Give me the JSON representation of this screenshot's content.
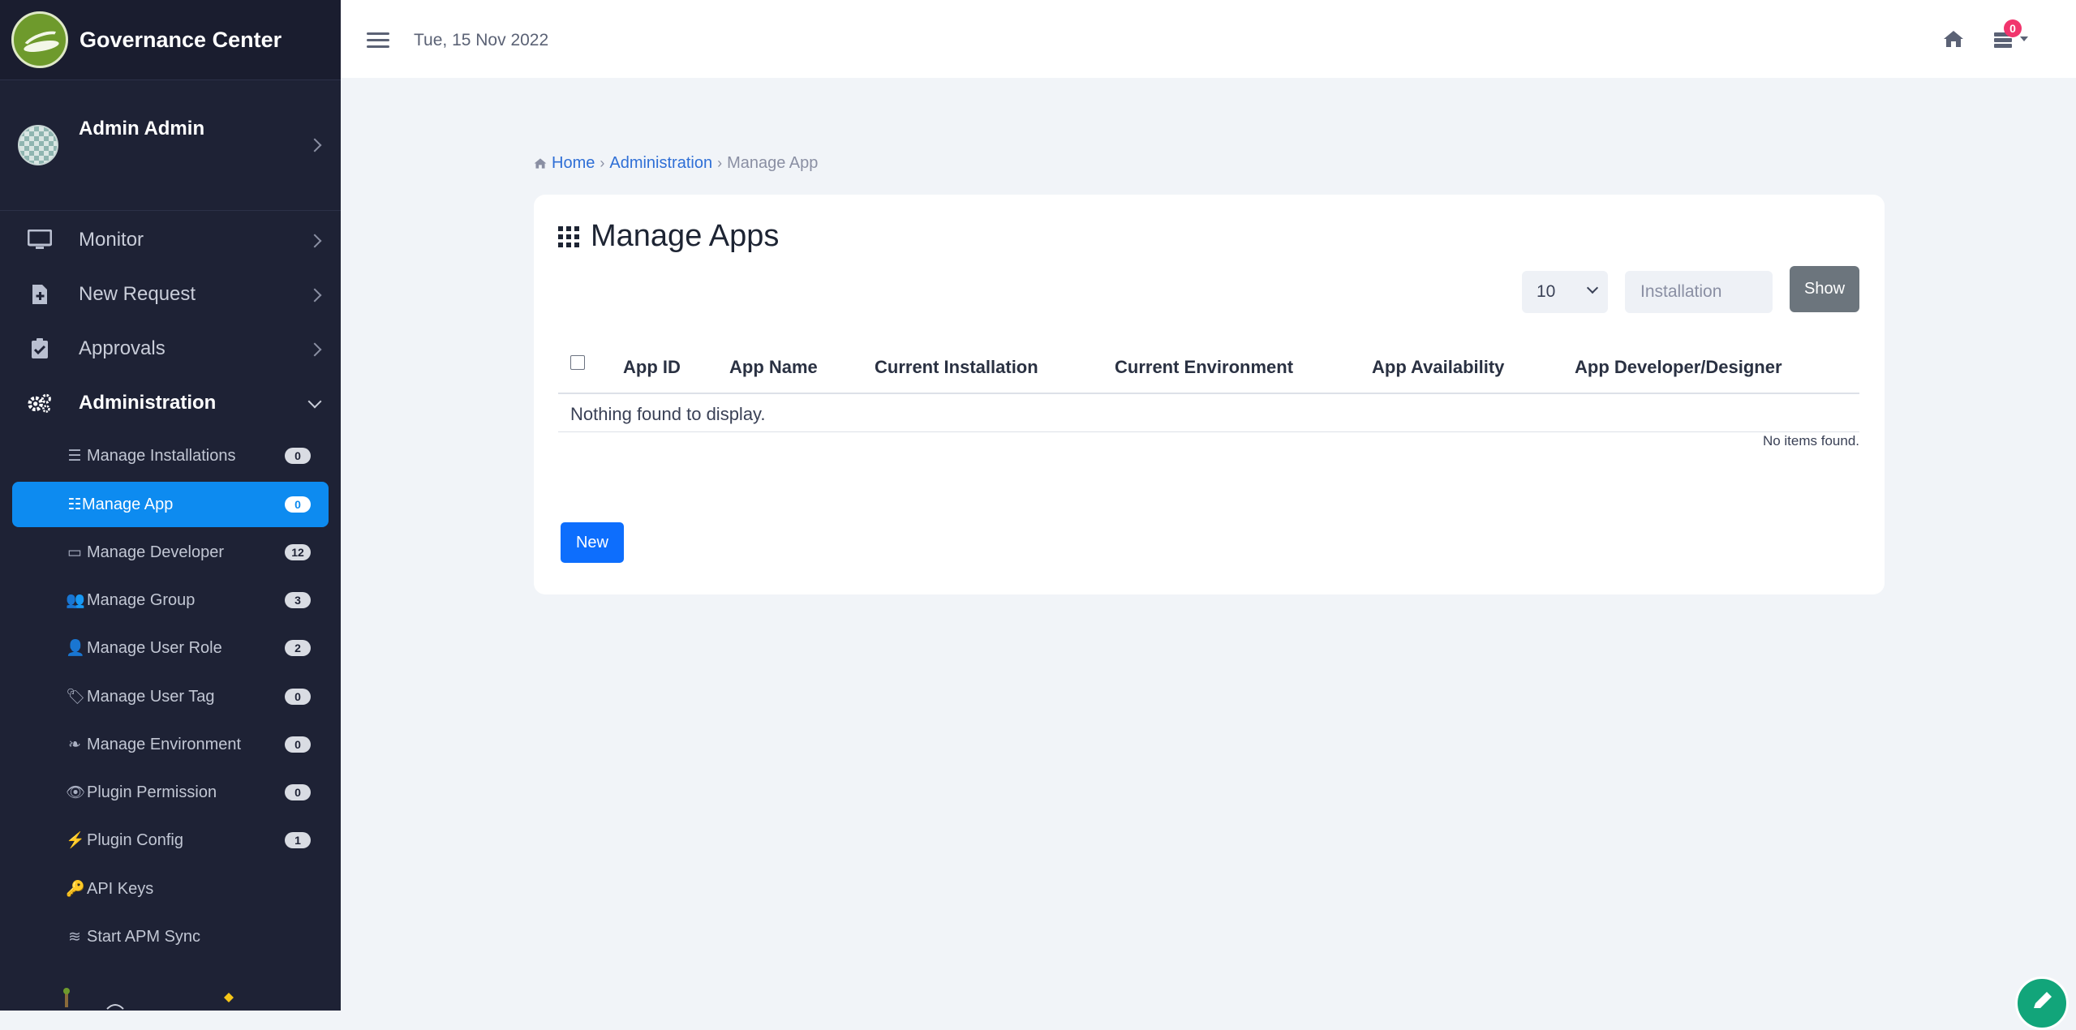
{
  "app": {
    "title": "Governance Center"
  },
  "user": {
    "name": "Admin Admin"
  },
  "topbar": {
    "date": "Tue, 15 Nov 2022",
    "notification_count": "0"
  },
  "sidebar": {
    "menu": [
      {
        "label": "Monitor",
        "icon": "monitor-icon"
      },
      {
        "label": "New Request",
        "icon": "file-plus-icon"
      },
      {
        "label": "Approvals",
        "icon": "clipboard-check-icon"
      },
      {
        "label": "Administration",
        "icon": "gears-icon",
        "expanded": true
      }
    ],
    "admin_items": [
      {
        "label": "Manage Installations",
        "icon": "server-icon",
        "badge": "0"
      },
      {
        "label": "Manage App",
        "icon": "grid-list-icon",
        "badge": "0",
        "active": true
      },
      {
        "label": "Manage Developer",
        "icon": "id-card-icon",
        "badge": "12"
      },
      {
        "label": "Manage Group",
        "icon": "users-icon",
        "badge": "3"
      },
      {
        "label": "Manage User Role",
        "icon": "user-tie-icon",
        "badge": "2"
      },
      {
        "label": "Manage User Tag",
        "icon": "tag-icon",
        "badge": "0"
      },
      {
        "label": "Manage Environment",
        "icon": "leaf-icon",
        "badge": "0"
      },
      {
        "label": "Plugin Permission",
        "icon": "eye-icon",
        "badge": "0"
      },
      {
        "label": "Plugin Config",
        "icon": "plug-icon",
        "badge": "1"
      },
      {
        "label": "API Keys",
        "icon": "key-icon"
      },
      {
        "label": "Start APM Sync",
        "icon": "layers-icon"
      }
    ]
  },
  "breadcrumb": {
    "home": "Home",
    "section": "Administration",
    "current": "Manage App"
  },
  "page": {
    "title": "Manage Apps",
    "page_size": "10",
    "filter_placeholder": "Installation",
    "show_button": "Show",
    "new_button": "New"
  },
  "table": {
    "columns": [
      "App ID",
      "App Name",
      "Current Installation",
      "Current Environment",
      "App Availability",
      "App Developer/Designer"
    ],
    "empty_message": "Nothing found to display.",
    "footer_message": "No items found."
  },
  "colors": {
    "sidebar_bg": "#1e2235",
    "active_item": "#0d8bf0",
    "primary_button": "#0d6efd",
    "notification_badge": "#f1356d"
  }
}
